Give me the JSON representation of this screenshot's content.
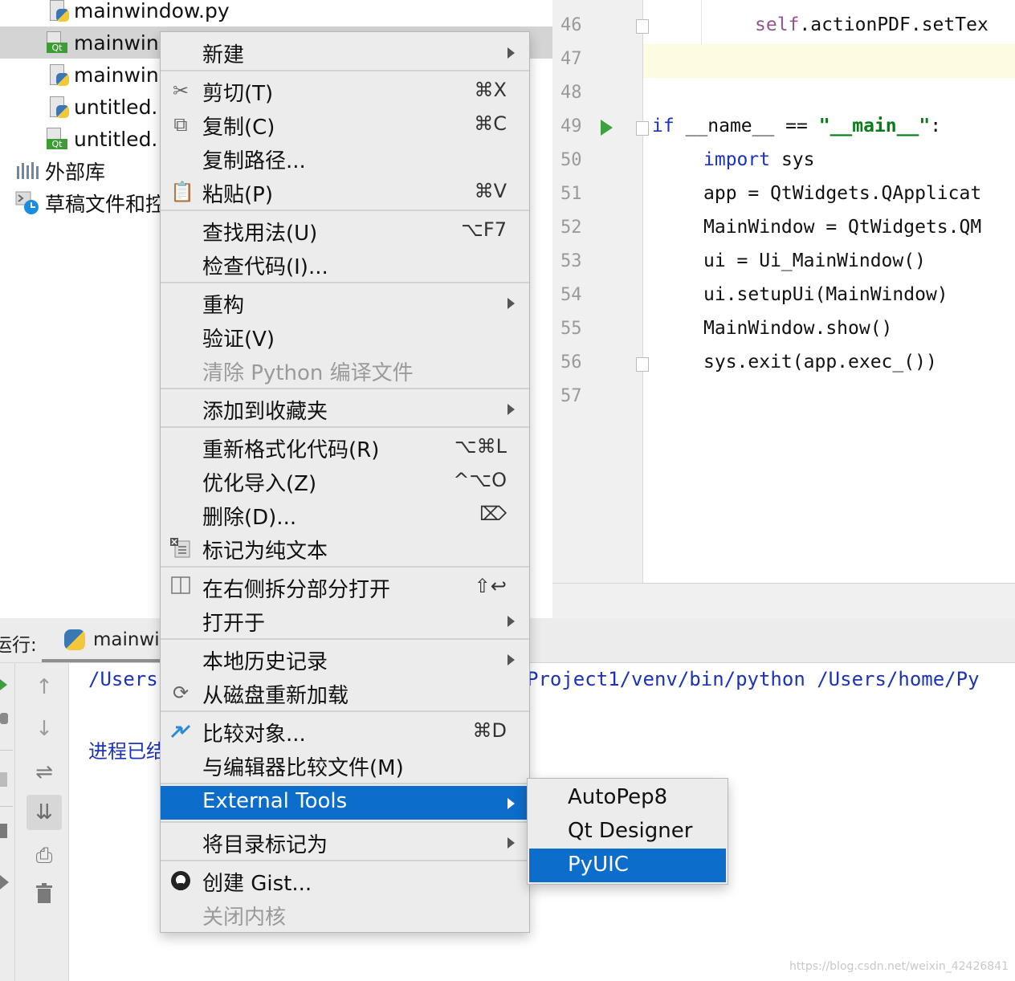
{
  "project_tree": {
    "items": [
      {
        "label": "mainwindow.py",
        "icon": "python-file-icon"
      },
      {
        "label": "mainwinc",
        "icon": "qt-file-icon"
      },
      {
        "label": "mainwinc",
        "icon": "python-file-icon"
      },
      {
        "label": "untitled.",
        "icon": "python-file-icon"
      },
      {
        "label": "untitled.",
        "icon": "qt-file-icon"
      },
      {
        "label": "外部库",
        "icon": "library-icon"
      },
      {
        "label": "草稿文件和控",
        "icon": "scratch-icon"
      }
    ]
  },
  "editor": {
    "line_numbers": [
      "46",
      "47",
      "48",
      "49",
      "50",
      "51",
      "52",
      "53",
      "54",
      "55",
      "56",
      "57"
    ],
    "lines": {
      "l46_self": "self",
      "l46_rest": ".actionPDF.setTex",
      "l49_if": "if",
      "l49_mid": " __name__ == ",
      "l49_str": "\"__main__\"",
      "l49_colon": ":",
      "l50_import": "import",
      "l50_rest": " sys",
      "l51": "app = QtWidgets.QApplicat",
      "l52": "MainWindow = QtWidgets.QM",
      "l53": "ui = Ui_MainWindow()",
      "l54": "ui.setupUi(MainWindow)",
      "l55": "MainWindow.show()",
      "l56": "sys.exit(app.exec_())"
    }
  },
  "run_panel": {
    "caption": "运行:",
    "tab_label": "mainwin",
    "console_line1_left": "/Users",
    "console_line1_right": "Project1/venv/bin/python /Users/home/Py",
    "console_line2": "进程已结"
  },
  "context_menu": {
    "items": [
      {
        "label": "新建",
        "submenu": true
      },
      {
        "label": "剪切(T)",
        "shortcut": "⌘X",
        "icon": "scissors-icon"
      },
      {
        "label": "复制(C)",
        "shortcut": "⌘C",
        "icon": "copy-icon"
      },
      {
        "label": "复制路径...",
        "shortcut": ""
      },
      {
        "label": "粘贴(P)",
        "shortcut": "⌘V",
        "icon": "paste-icon"
      },
      {
        "label": "查找用法(U)",
        "shortcut": "⌥F7"
      },
      {
        "label": "检查代码(I)..."
      },
      {
        "label": "重构",
        "submenu": true
      },
      {
        "label": "验证(V)"
      },
      {
        "label": "清除 Python 编译文件",
        "disabled": true
      },
      {
        "label": "添加到收藏夹",
        "submenu": true
      },
      {
        "label": "重新格式化代码(R)",
        "shortcut": "⌥⌘L"
      },
      {
        "label": "优化导入(Z)",
        "shortcut": "^⌥O"
      },
      {
        "label": "删除(D)...",
        "shortcut": "⌦"
      },
      {
        "label": "标记为纯文本",
        "icon": "plain-text-icon"
      },
      {
        "label": "在右侧拆分部分打开",
        "shortcut": "⇧↩",
        "icon": "split-icon"
      },
      {
        "label": "打开于",
        "submenu": true
      },
      {
        "label": "本地历史记录",
        "submenu": true
      },
      {
        "label": "从磁盘重新加载",
        "icon": "reload-icon"
      },
      {
        "label": "比较对象...",
        "shortcut": "⌘D",
        "icon": "compare-icon"
      },
      {
        "label": "与编辑器比较文件(M)"
      },
      {
        "label": "External Tools",
        "submenu": true,
        "highlighted": true
      },
      {
        "label": "将目录标记为",
        "submenu": true
      },
      {
        "label": "创建 Gist...",
        "icon": "github-icon"
      },
      {
        "label": "关闭内核",
        "disabled": true
      }
    ]
  },
  "external_tools_submenu": {
    "items": [
      {
        "label": "AutoPep8"
      },
      {
        "label": "Qt Designer"
      },
      {
        "label": "PyUIC",
        "highlighted": true
      }
    ]
  },
  "watermark": "https://blog.csdn.net/weixin_42426841",
  "colors": {
    "highlight": "#0d6dcb",
    "keyword": "#1c32b8",
    "string": "#067d17",
    "self": "#94558d",
    "current_line": "#fdfce0"
  }
}
